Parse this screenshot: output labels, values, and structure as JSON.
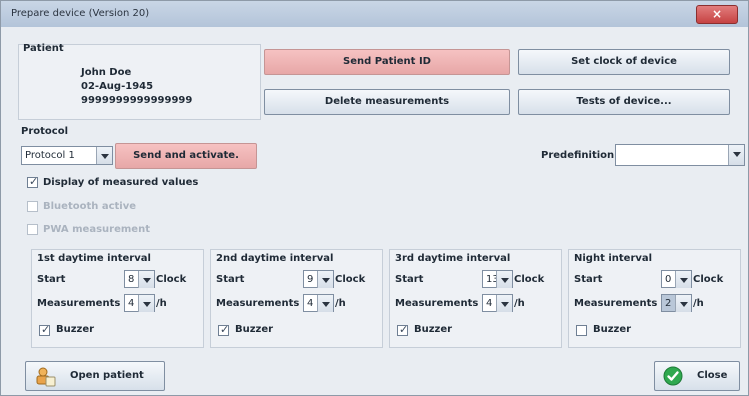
{
  "window": {
    "title": "Prepare device (Version 20)",
    "close_glyph": "×"
  },
  "patient": {
    "section_label": "Patient",
    "name": "John Doe",
    "birth_date": "02-Aug-1945",
    "id_number": "9999999999999999"
  },
  "actions": {
    "send_patient_id": "Send Patient ID",
    "set_clock": "Set clock of device",
    "delete_measurements": "Delete measurements",
    "tests_device": "Tests of device..."
  },
  "protocol": {
    "section_label": "Protocol",
    "selected": "Protocol 1",
    "send_activate": "Send and activate.",
    "predefinition_label": "Predefinition",
    "predefinition_value": ""
  },
  "options": {
    "display_measured": {
      "label": "Display of measured values",
      "checked": true
    },
    "bluetooth": {
      "label": "Bluetooth active",
      "checked": false
    },
    "pwa": {
      "label": "PWA measurement",
      "checked": false
    }
  },
  "intervals": [
    {
      "title": "1st daytime interval",
      "start_label": "Start",
      "start_value": "8",
      "clock_label": "Clock",
      "meas_label": "Measurements",
      "meas_value": "4",
      "per_label": "/h",
      "buzzer_label": "Buzzer",
      "buzzer_checked": true
    },
    {
      "title": "2nd daytime interval",
      "start_label": "Start",
      "start_value": "9",
      "clock_label": "Clock",
      "meas_label": "Measurements",
      "meas_value": "4",
      "per_label": "/h",
      "buzzer_label": "Buzzer",
      "buzzer_checked": true
    },
    {
      "title": "3rd daytime interval",
      "start_label": "Start",
      "start_value": "13",
      "clock_label": "Clock",
      "meas_label": "Measurements",
      "meas_value": "4",
      "per_label": "/h",
      "buzzer_label": "Buzzer",
      "buzzer_checked": true
    },
    {
      "title": "Night interval",
      "start_label": "Start",
      "start_value": "0",
      "clock_label": "Clock",
      "meas_label": "Measurements",
      "meas_value": "2",
      "per_label": "/h",
      "buzzer_label": "Buzzer",
      "buzzer_checked": false
    }
  ],
  "footer": {
    "open_patient": "Open patient",
    "close": "Close"
  },
  "colors": {
    "accent_pink": "#e7a7a7",
    "close_red": "#c64343",
    "ok_green": "#2fa84f"
  },
  "icons": {
    "open_patient": "user-folder-icon",
    "close": "check-circle-icon"
  }
}
